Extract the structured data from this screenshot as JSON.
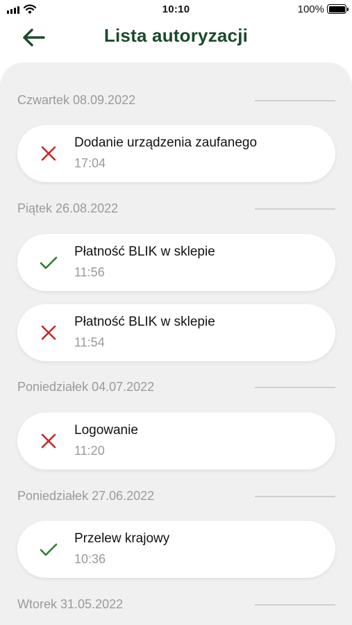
{
  "status_bar": {
    "time": "10:10",
    "battery": "100%"
  },
  "header": {
    "title": "Lista autoryzacji"
  },
  "colors": {
    "title": "#1a4a2b",
    "success": "#2e7d32",
    "failure": "#c62828"
  },
  "groups": [
    {
      "date": "Czwartek 08.09.2022",
      "items": [
        {
          "title": "Dodanie urządzenia zaufanego",
          "time": "17:04",
          "status": "failure",
          "icon": "cross-icon"
        }
      ]
    },
    {
      "date": "Piątek 26.08.2022",
      "items": [
        {
          "title": "Płatność BLIK w sklepie",
          "time": "11:56",
          "status": "success",
          "icon": "check-icon"
        },
        {
          "title": "Płatność BLIK w sklepie",
          "time": "11:54",
          "status": "failure",
          "icon": "cross-icon"
        }
      ]
    },
    {
      "date": "Poniedziałek 04.07.2022",
      "items": [
        {
          "title": "Logowanie",
          "time": "11:20",
          "status": "failure",
          "icon": "cross-icon"
        }
      ]
    },
    {
      "date": "Poniedziałek 27.06.2022",
      "items": [
        {
          "title": "Przelew krajowy",
          "time": "10:36",
          "status": "success",
          "icon": "check-icon"
        }
      ]
    },
    {
      "date": "Wtorek 31.05.2022",
      "items": []
    }
  ]
}
